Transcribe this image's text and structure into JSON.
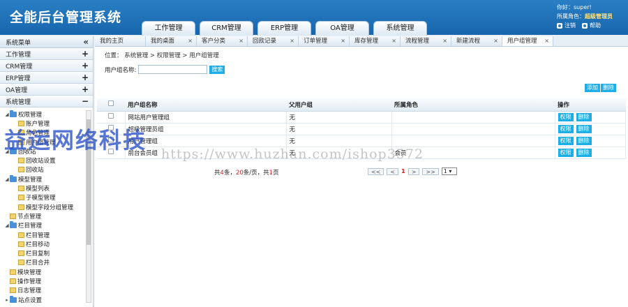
{
  "header": {
    "title": "全能后台管理系统",
    "nav": [
      "工作管理",
      "CRM管理",
      "ERP管理",
      "OA管理",
      "系统管理"
    ],
    "user": {
      "greeting": "你好：super!",
      "role_label": "所属角色：",
      "role": "超级管理员",
      "logout": "注销",
      "help": "帮助"
    }
  },
  "sidebar": {
    "title": "系统菜单",
    "collapse_icon": "«",
    "groups": [
      {
        "label": "工作管理",
        "sign": "+"
      },
      {
        "label": "CRM管理",
        "sign": "+"
      },
      {
        "label": "ERP管理",
        "sign": "+"
      },
      {
        "label": "OA管理",
        "sign": "+"
      },
      {
        "label": "系统管理",
        "sign": "−"
      }
    ],
    "tree": [
      {
        "label": "权限管理",
        "level": 0,
        "folder": true,
        "open": true
      },
      {
        "label": "账户管理",
        "level": 1
      },
      {
        "label": "角色管理",
        "level": 1
      },
      {
        "label": "用户组管理",
        "level": 1
      },
      {
        "label": "回收站",
        "level": 0,
        "folder": true,
        "open": true
      },
      {
        "label": "回收站设置",
        "level": 1
      },
      {
        "label": "回收站",
        "level": 1
      },
      {
        "label": "模型管理",
        "level": 0,
        "folder": true,
        "open": true
      },
      {
        "label": "模型列表",
        "level": 1
      },
      {
        "label": "子模型管理",
        "level": 1
      },
      {
        "label": "模型字段分组管理",
        "level": 1
      },
      {
        "label": "节点管理",
        "level": 0
      },
      {
        "label": "栏目管理",
        "level": 0,
        "folder": true,
        "open": true
      },
      {
        "label": "栏目管理",
        "level": 1
      },
      {
        "label": "栏目移动",
        "level": 1
      },
      {
        "label": "栏目复制",
        "level": 1
      },
      {
        "label": "栏目合并",
        "level": 1
      },
      {
        "label": "模块管理",
        "level": 0
      },
      {
        "label": "操作管理",
        "level": 0
      },
      {
        "label": "日志管理",
        "level": 0
      },
      {
        "label": "站点设置",
        "level": 0,
        "folder": true,
        "open": false
      }
    ]
  },
  "tabs": [
    {
      "label": "我的主页",
      "close": false
    },
    {
      "label": "我的桌面",
      "close": true
    },
    {
      "label": "客户分类",
      "close": true
    },
    {
      "label": "回款记录",
      "close": true
    },
    {
      "label": "订单管理",
      "close": true
    },
    {
      "label": "库存管理",
      "close": true
    },
    {
      "label": "流程管理",
      "close": true
    },
    {
      "label": "新建流程",
      "close": true
    },
    {
      "label": "用户组管理",
      "close": true,
      "active": true
    }
  ],
  "breadcrumb": "位置： 系统管理 > 权限管理 > 用户组管理",
  "search": {
    "label": "用户组名称:",
    "value": "",
    "placeholder": "",
    "button": "搜索"
  },
  "toolbar": {
    "add": "添加",
    "delete": "删除"
  },
  "table": {
    "headers": [
      "",
      "用户组名称",
      "父用户组",
      "所属角色",
      "操作"
    ],
    "rows": [
      {
        "name": "网站用户管理组",
        "parent": "无",
        "role": ""
      },
      {
        "name": "超级管理员组",
        "parent": "无",
        "role": ""
      },
      {
        "name": "用户管理组",
        "parent": "无",
        "role": ""
      },
      {
        "name": "前台会员组",
        "parent": "无",
        "role": "会员"
      }
    ],
    "row_actions": [
      "权限",
      "删除"
    ]
  },
  "pager": {
    "text_prefix": "共",
    "total": "4",
    "text_mid1": "条，",
    "per_page": "20",
    "text_mid2": "条/页，共",
    "pages": "1",
    "text_suffix": "页",
    "first": "<<",
    "prev": "<",
    "current": "1",
    "next": ">",
    "last": ">>",
    "select": "1 ▾"
  },
  "watermark": {
    "cn": "益运网络科技",
    "url": "https://www.huzhan.com/ishop3572"
  },
  "colors": {
    "header": "#1766ad",
    "button": "#1eaee6",
    "role": "#ffe27a"
  }
}
